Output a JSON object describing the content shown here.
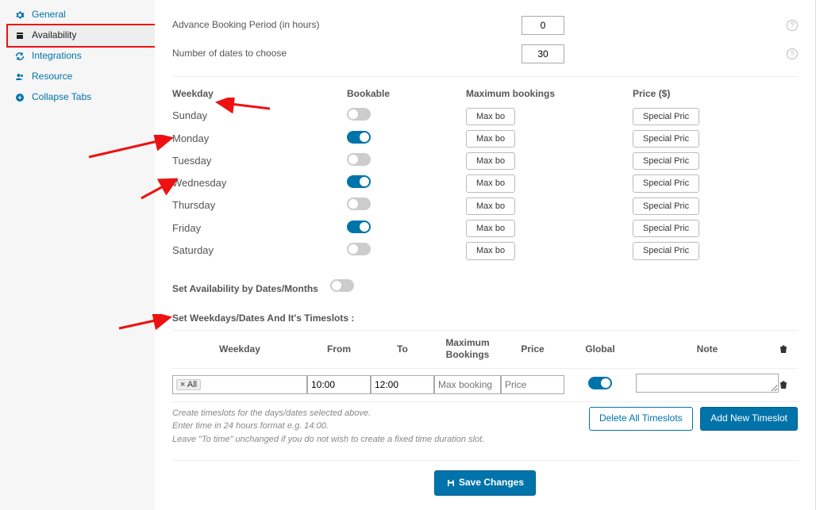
{
  "sidebar": {
    "items": [
      {
        "label": "General",
        "icon": "gear-icon"
      },
      {
        "label": "Availability",
        "icon": "calendar-icon"
      },
      {
        "label": "Integrations",
        "icon": "refresh-icon"
      },
      {
        "label": "Resource",
        "icon": "users-icon"
      },
      {
        "label": "Collapse Tabs",
        "icon": "circle-plus-icon"
      }
    ]
  },
  "top": {
    "advLabel": "Advance Booking Period (in hours)",
    "advValue": "0",
    "numLabel": "Number of dates to choose",
    "numValue": "30"
  },
  "weekHead": {
    "weekday": "Weekday",
    "bookable": "Bookable",
    "max": "Maximum bookings",
    "price": "Price ($)"
  },
  "days": [
    {
      "name": "Sunday",
      "on": false
    },
    {
      "name": "Monday",
      "on": true
    },
    {
      "name": "Tuesday",
      "on": false
    },
    {
      "name": "Wednesday",
      "on": true
    },
    {
      "name": "Thursday",
      "on": false
    },
    {
      "name": "Friday",
      "on": true
    },
    {
      "name": "Saturday",
      "on": false
    }
  ],
  "maxBtn": "Max bo",
  "priceBtn": "Special Pric",
  "setAvail": "Set Availability by Dates/Months",
  "setTs": "Set Weekdays/Dates And It's Timeslots :",
  "tsHead": {
    "weekday": "Weekday",
    "from": "From",
    "to": "To",
    "max": "Maximum Bookings",
    "price": "Price",
    "global": "Global",
    "note": "Note"
  },
  "tsRow": {
    "tag": "× All",
    "from": "10:00",
    "to": "12:00",
    "maxPh": "Max booking",
    "pricePh": "Price",
    "globalOn": true
  },
  "hints": [
    "Create timeslots for the days/dates selected above.",
    "Enter time in 24 hours format e.g. 14:00.",
    "Leave \"To time\" unchanged if you do not wish to create a fixed time duration slot."
  ],
  "buttons": {
    "delete": "Delete All Timeslots",
    "add": "Add New Timeslot",
    "save": "Save Changes"
  }
}
